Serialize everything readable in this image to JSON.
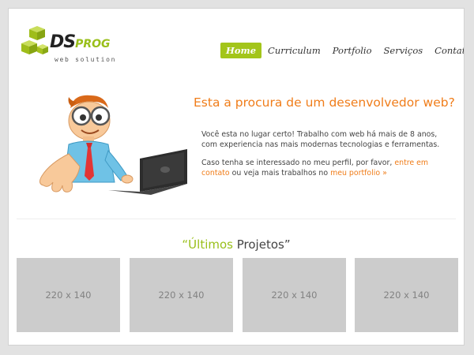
{
  "logo": {
    "word_main": "DS",
    "word_accent": "PROG",
    "tagline": "web solution"
  },
  "nav": {
    "items": [
      {
        "label": "Home",
        "active": true
      },
      {
        "label": "Curriculum",
        "active": false
      },
      {
        "label": "Portfolio",
        "active": false
      },
      {
        "label": "Serviços",
        "active": false
      },
      {
        "label": "Contato",
        "active": false
      }
    ]
  },
  "hero": {
    "title": "Esta a procura de um desenvolvedor web?",
    "paragraph1": "Você esta no lugar certo! Trabalho com web há mais de 8 anos, com experiencia nas mais modernas tecnologias e ferramentas.",
    "paragraph2_start": "Caso tenha se interessado no meu perfil, por favor,",
    "paragraph2_link1": "entre em contato",
    "paragraph2_middle": "ou veja mais trabalhos no",
    "paragraph2_link2": "meu portfolio »"
  },
  "projects": {
    "open_quote": "“",
    "title_highlight": "Últimos",
    "title_rest": " Projetos",
    "close_quote": "”",
    "thumbnails": [
      {
        "label": "220 x 140"
      },
      {
        "label": "220 x 140"
      },
      {
        "label": "220 x 140"
      },
      {
        "label": "220 x 140"
      }
    ]
  },
  "colors": {
    "accent_green": "#a3c51a",
    "accent_orange": "#f07d1a",
    "placeholder_gray": "#cccccc"
  }
}
